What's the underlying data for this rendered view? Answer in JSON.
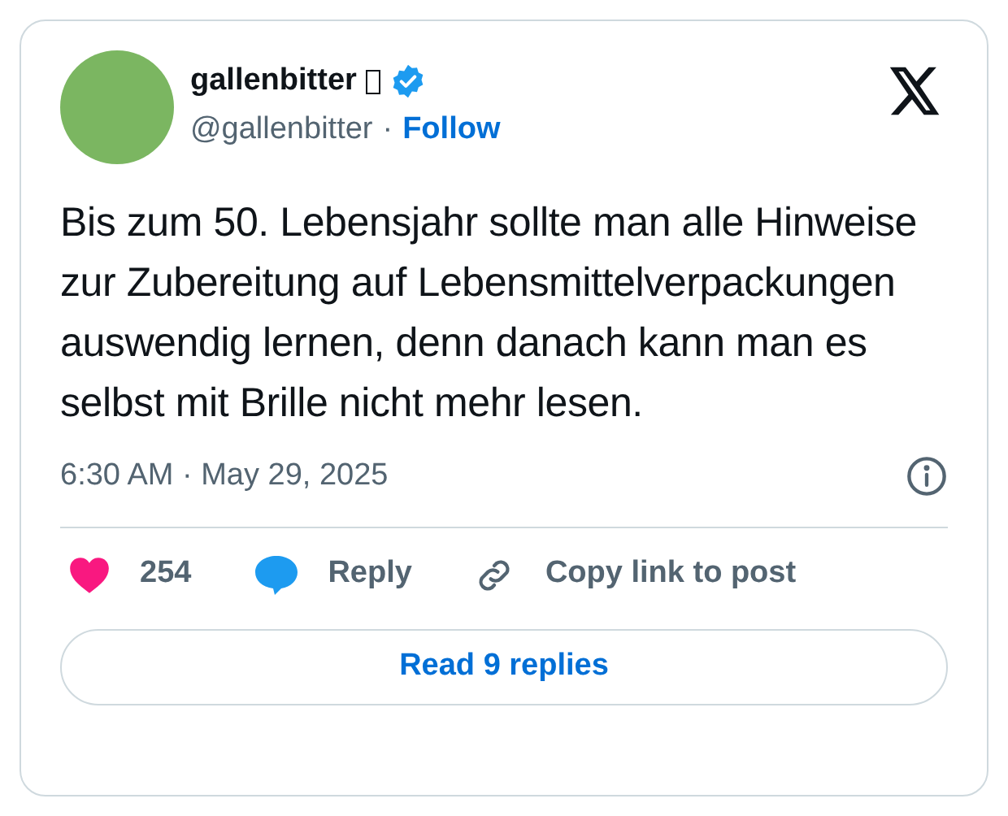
{
  "author": {
    "name": "gallenbitter",
    "verified": true,
    "handle": "@gallenbitter",
    "separator": "·",
    "follow": "Follow"
  },
  "text": "Bis zum 50. Lebensjahr sollte man alle Hinweise zur Zubereitung auf Lebensmittelverpackungen auswendig lernen, denn danach kann man es selbst mit Brille nicht mehr lesen.",
  "timestamp": "6:30 AM · May 29, 2025",
  "actions": [
    {
      "kind": "like",
      "label": "254"
    },
    {
      "kind": "reply",
      "label": "Reply"
    },
    {
      "kind": "copy",
      "label": "Copy link to post"
    }
  ],
  "read_button": "Read 9 replies"
}
